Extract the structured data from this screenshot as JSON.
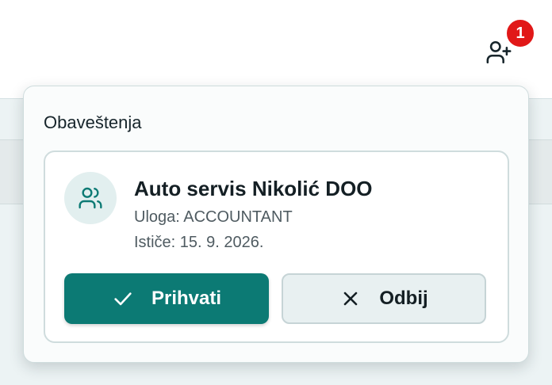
{
  "header": {
    "invite_icon": "user-plus-icon",
    "badge_count": "1",
    "badge_color": "#e11818"
  },
  "notifications": {
    "title": "Obaveštenja",
    "items": [
      {
        "icon": "users-icon",
        "company": "Auto servis Nikolić DOO",
        "role_line": "Uloga: ACCOUNTANT",
        "expiry_line": "Ističe: 15. 9. 2026.",
        "accept_label": "Prihvati",
        "accept_icon": "check-icon",
        "decline_label": "Odbij",
        "decline_icon": "close-icon"
      }
    ]
  },
  "colors": {
    "accent": "#0c7a74",
    "avatar_bg": "#e2efef",
    "decline_bg": "#e8f0f1"
  }
}
